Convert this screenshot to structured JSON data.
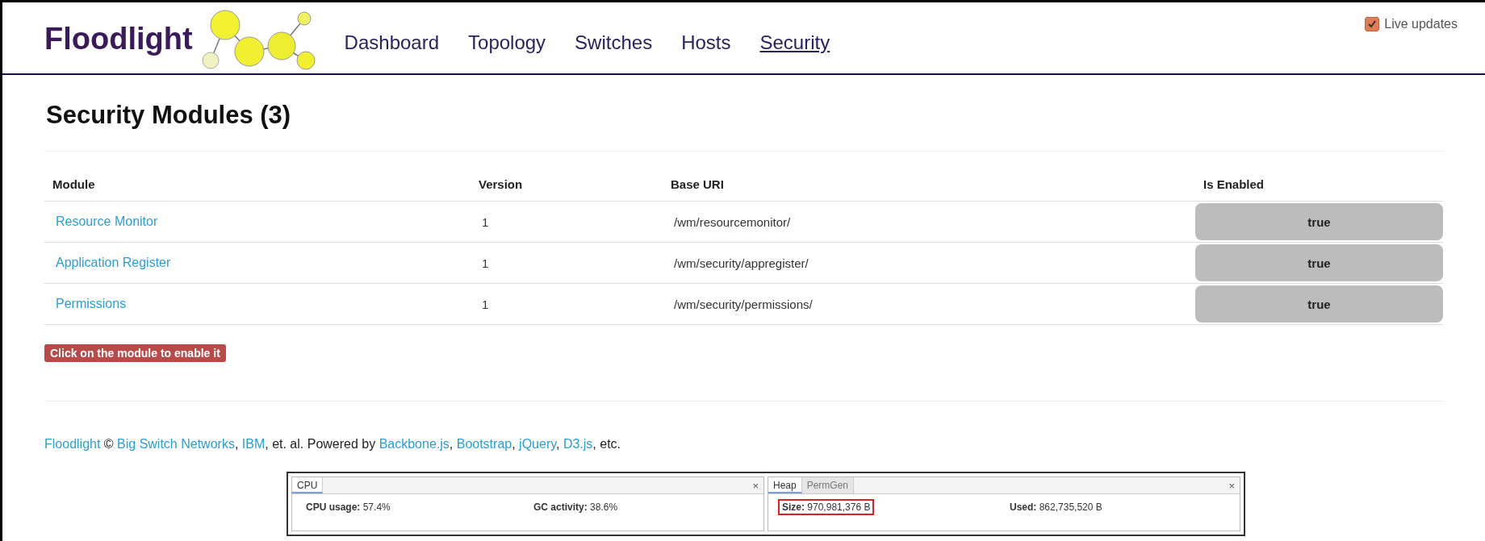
{
  "header": {
    "logo": "Floodlight",
    "nav": [
      {
        "label": "Dashboard",
        "selected": false
      },
      {
        "label": "Topology",
        "selected": false
      },
      {
        "label": "Switches",
        "selected": false
      },
      {
        "label": "Hosts",
        "selected": false
      },
      {
        "label": "Security",
        "selected": true
      }
    ],
    "live_updates": {
      "label": "Live updates",
      "checked": true
    }
  },
  "title": "Security Modules (3)",
  "table": {
    "columns": [
      "Module",
      "Version",
      "Base URI",
      "Is Enabled"
    ],
    "rows": [
      {
        "module": "Resource Monitor",
        "version": "1",
        "base_uri": "/wm/resourcemonitor/",
        "enabled": "true"
      },
      {
        "module": "Application Register",
        "version": "1",
        "base_uri": "/wm/security/appregister/",
        "enabled": "true"
      },
      {
        "module": "Permissions",
        "version": "1",
        "base_uri": "/wm/security/permissions/",
        "enabled": "true"
      }
    ]
  },
  "hint_label": "Click on the module to enable it",
  "footer": [
    {
      "text": "Floodlight",
      "link": true
    },
    {
      "text": " © ",
      "link": false
    },
    {
      "text": "Big Switch Networks",
      "link": true
    },
    {
      "text": ", ",
      "link": false
    },
    {
      "text": "IBM",
      "link": true
    },
    {
      "text": ", et. al. Powered by ",
      "link": false
    },
    {
      "text": "Backbone.js",
      "link": true
    },
    {
      "text": ", ",
      "link": false
    },
    {
      "text": "Bootstrap",
      "link": true
    },
    {
      "text": ", ",
      "link": false
    },
    {
      "text": "jQuery",
      "link": true
    },
    {
      "text": ", ",
      "link": false
    },
    {
      "text": "D3.js",
      "link": true
    },
    {
      "text": ", etc.",
      "link": false
    }
  ],
  "monitor": {
    "left_tab": "CPU",
    "left_stats": [
      "CPU usage: 57.4%",
      "GC activity: 38.6%"
    ],
    "right_tabs": [
      {
        "label": "Heap",
        "selected": true
      },
      {
        "label": "PermGen",
        "selected": false
      }
    ],
    "right_stats": [
      "Size: 970,981,376 B",
      "Used: 862,735,520 B"
    ],
    "close": "×"
  }
}
